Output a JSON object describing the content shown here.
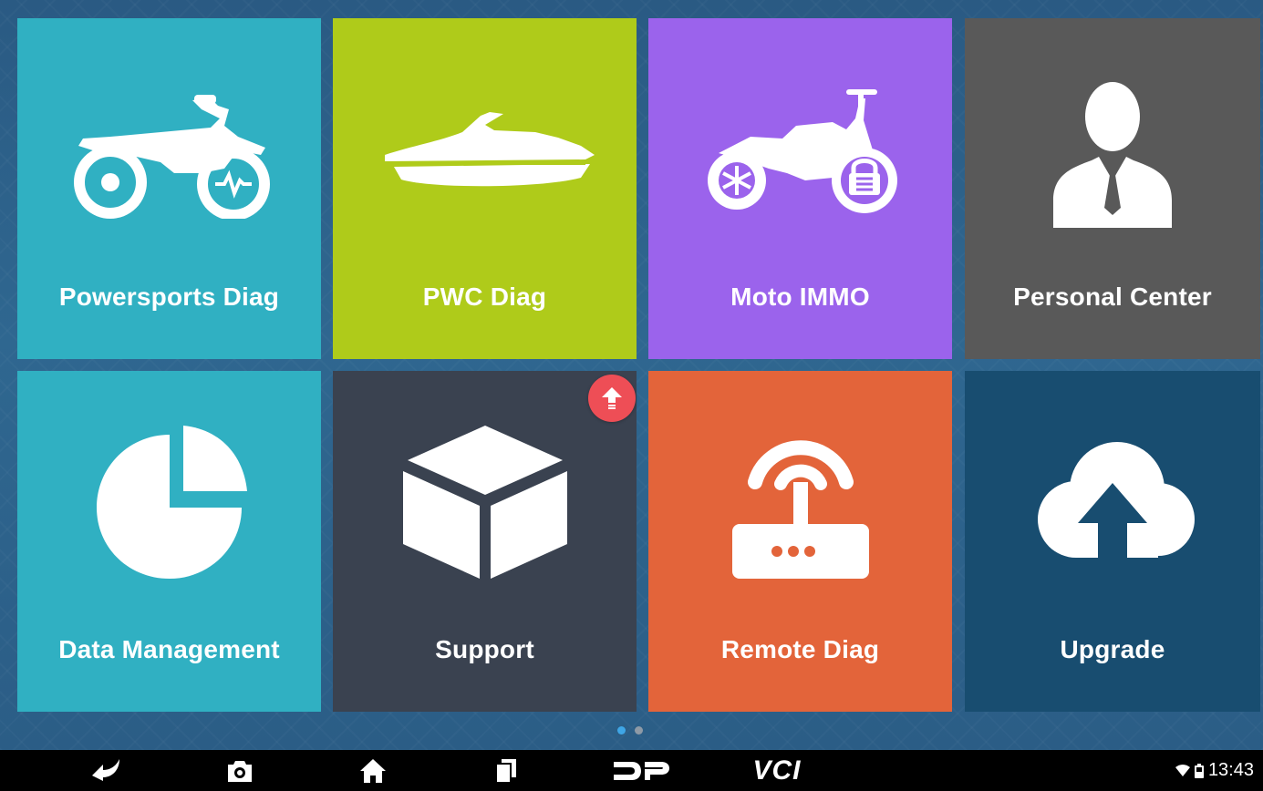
{
  "tiles": [
    {
      "label": "Powersports Diag",
      "icon": "dirt-bike-icon",
      "color": "#30b0c2"
    },
    {
      "label": "PWC Diag",
      "icon": "jet-ski-icon",
      "color": "#afcb1a"
    },
    {
      "label": "Moto IMMO",
      "icon": "motorcycle-lock-icon",
      "color": "#9b63ec"
    },
    {
      "label": "Personal Center",
      "icon": "person-icon",
      "color": "#595959"
    },
    {
      "label": "Data Management",
      "icon": "pie-chart-icon",
      "color": "#30b0c2"
    },
    {
      "label": "Support",
      "icon": "box-icon",
      "color": "#3a4250"
    },
    {
      "label": "Remote Diag",
      "icon": "router-icon",
      "color": "#e3643a"
    },
    {
      "label": "Upgrade",
      "icon": "cloud-upload-icon",
      "color": "#184d70"
    }
  ],
  "update_badge": {
    "icon": "upload-arrow-icon",
    "color": "#ee4e56"
  },
  "pager": {
    "pages": 2,
    "current": 1
  },
  "navbar": {
    "buttons": [
      "back-icon",
      "camera-icon",
      "home-icon",
      "recent-apps-icon",
      "dp-logo-icon"
    ],
    "vci_label": "VCI"
  },
  "status_bar": {
    "time": "13:43",
    "icons": [
      "wifi-icon",
      "battery-icon"
    ]
  }
}
